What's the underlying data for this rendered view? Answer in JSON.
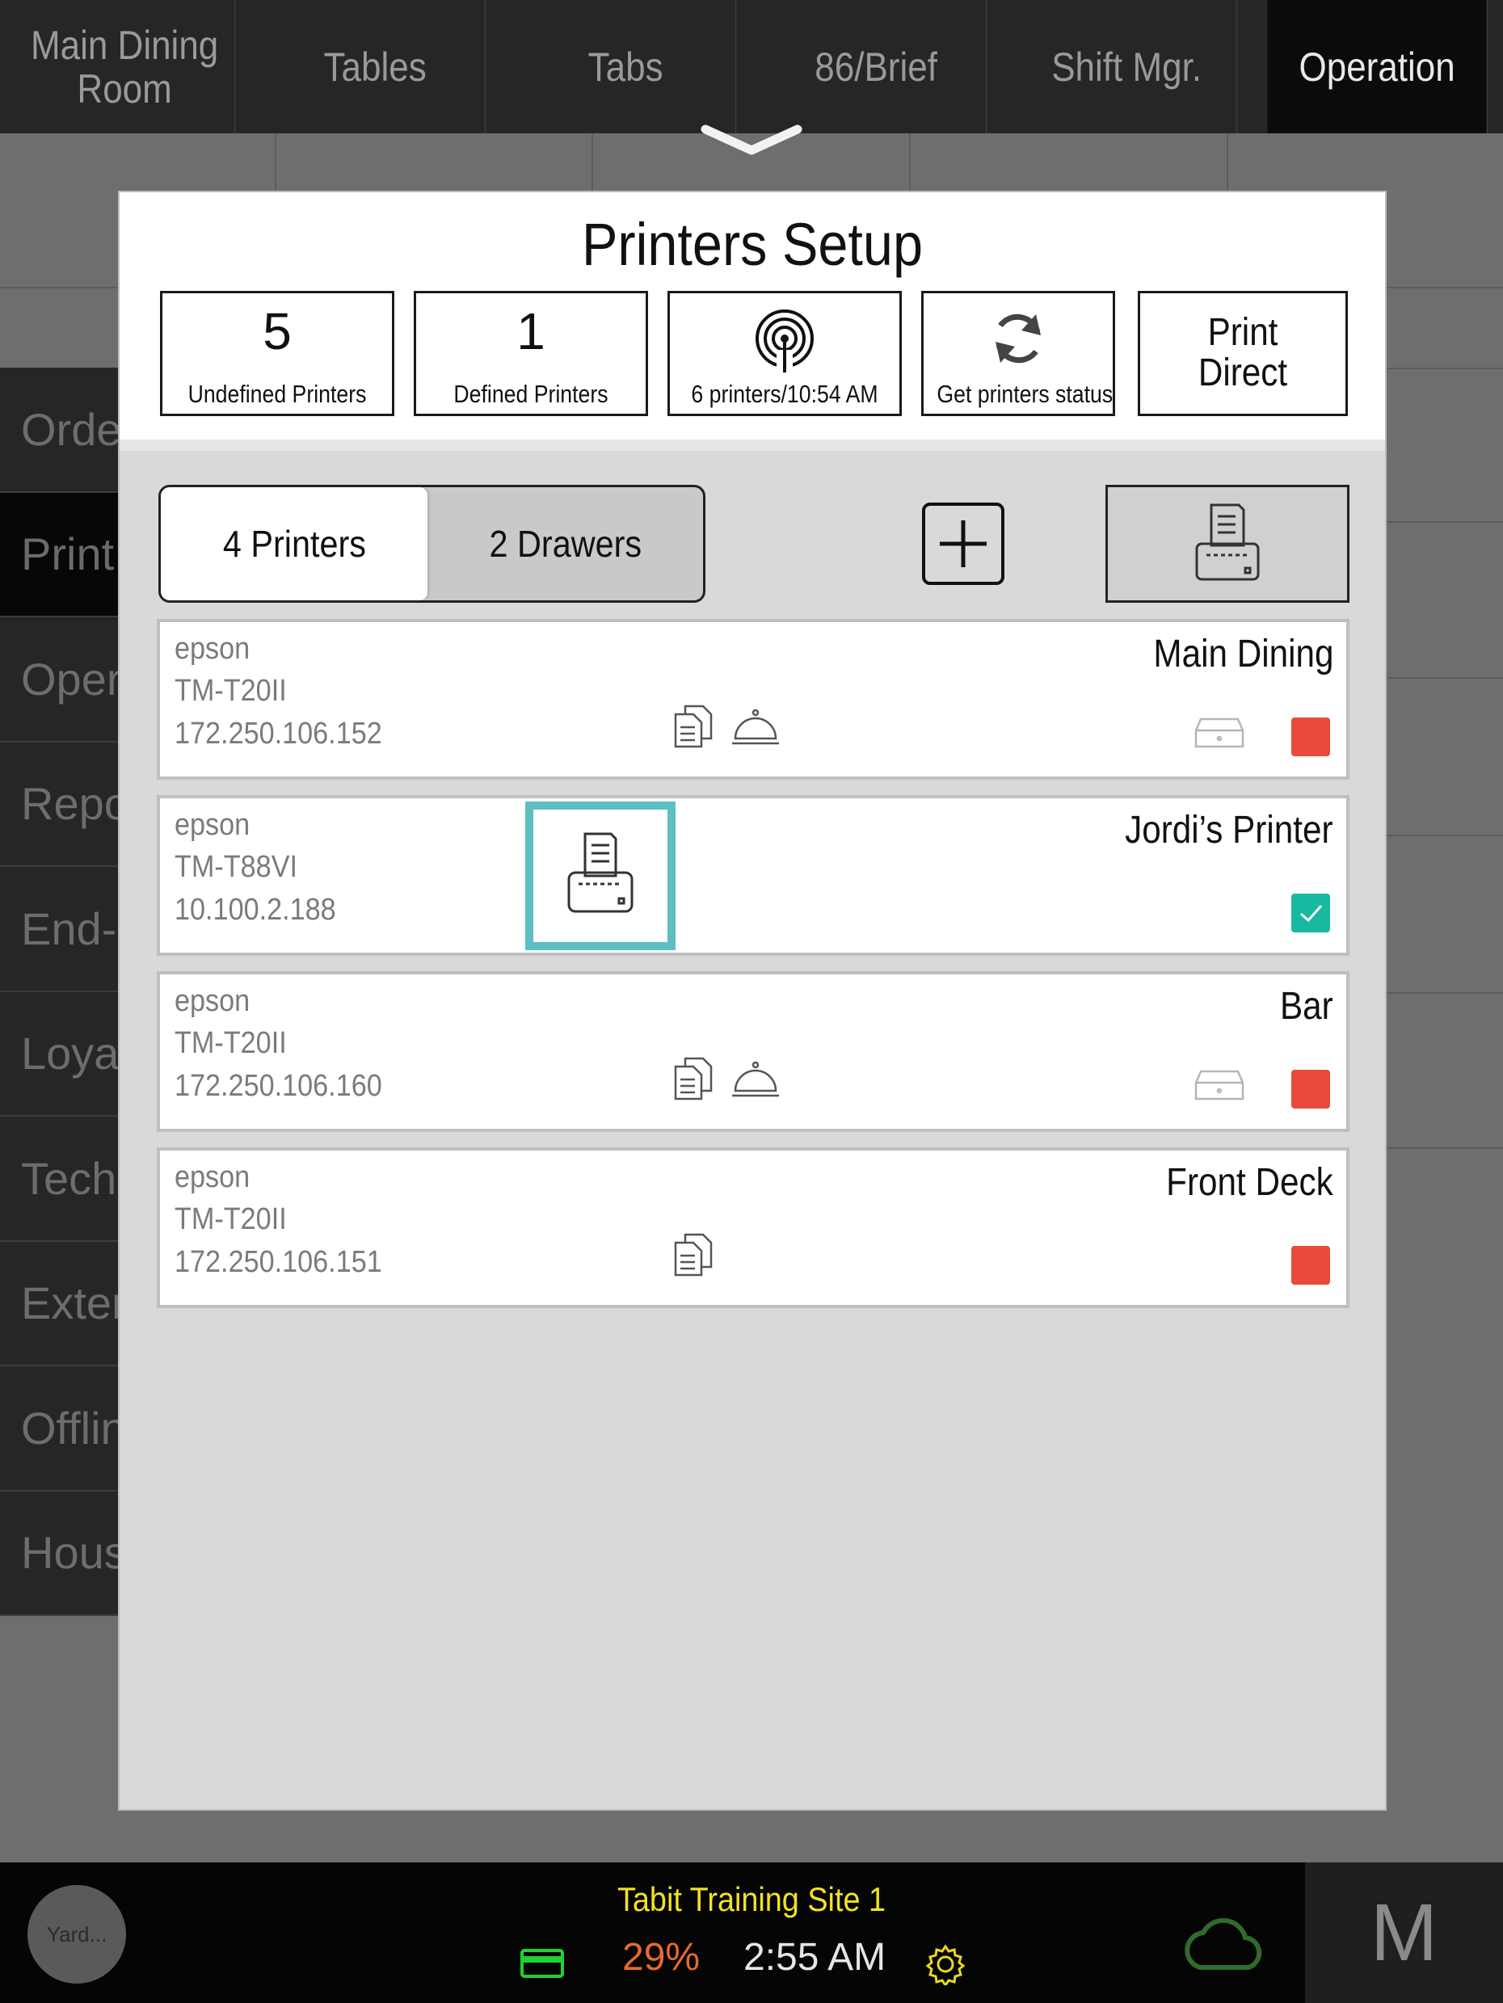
{
  "nav": {
    "tabs": [
      {
        "label": "Main Dining\nRoom"
      },
      {
        "label": "Tables"
      },
      {
        "label": "Tabs"
      },
      {
        "label": "86/Brief"
      },
      {
        "label": "Shift Mgr."
      },
      {
        "label": "Operation"
      }
    ]
  },
  "sidemenu": {
    "items": [
      {
        "label": "Orde"
      },
      {
        "label": "Print"
      },
      {
        "label": "Oper"
      },
      {
        "label": "Repo"
      },
      {
        "label": "End-"
      },
      {
        "label": "Loya"
      },
      {
        "label": "Tech"
      },
      {
        "label": "Exter"
      },
      {
        "label": "Offlin"
      },
      {
        "label": "Hous"
      }
    ]
  },
  "modal": {
    "title": "Printers Setup",
    "stats": {
      "undefined_count": "5",
      "undefined_label": "Undefined Printers",
      "defined_count": "1",
      "defined_label": "Defined Printers",
      "scan_label": "6 printers/10:54 AM",
      "status_label": "Get printers status",
      "print_direct_label": "Print\nDirect"
    },
    "segment": {
      "printers_label": "4 Printers",
      "drawers_label": "2 Drawers"
    },
    "printers": [
      {
        "brand": "epson",
        "model": "TM-T20II",
        "ip": "172.250.106.152",
        "name": "Main Dining",
        "status": "red"
      },
      {
        "brand": "epson",
        "model": "TM-T88VI",
        "ip": "10.100.2.188",
        "name": "Jordi’s Printer",
        "status": "ok"
      },
      {
        "brand": "epson",
        "model": "TM-T20II",
        "ip": "172.250.106.160",
        "name": "Bar",
        "status": "red"
      },
      {
        "brand": "epson",
        "model": "TM-T20II",
        "ip": "172.250.106.151",
        "name": "Front Deck",
        "status": "red"
      }
    ]
  },
  "bottombar": {
    "avatar": "Yard...",
    "site": "Tabit Training Site 1",
    "battery": "29%",
    "time": "2:55 AM",
    "mode_letter": "M"
  },
  "colors": {
    "status_red": "#e84b3b",
    "status_ok": "#18b9a0",
    "highlight": "#5cbfc3",
    "site_text": "#f2e320",
    "battery_text": "#e66a2c"
  }
}
